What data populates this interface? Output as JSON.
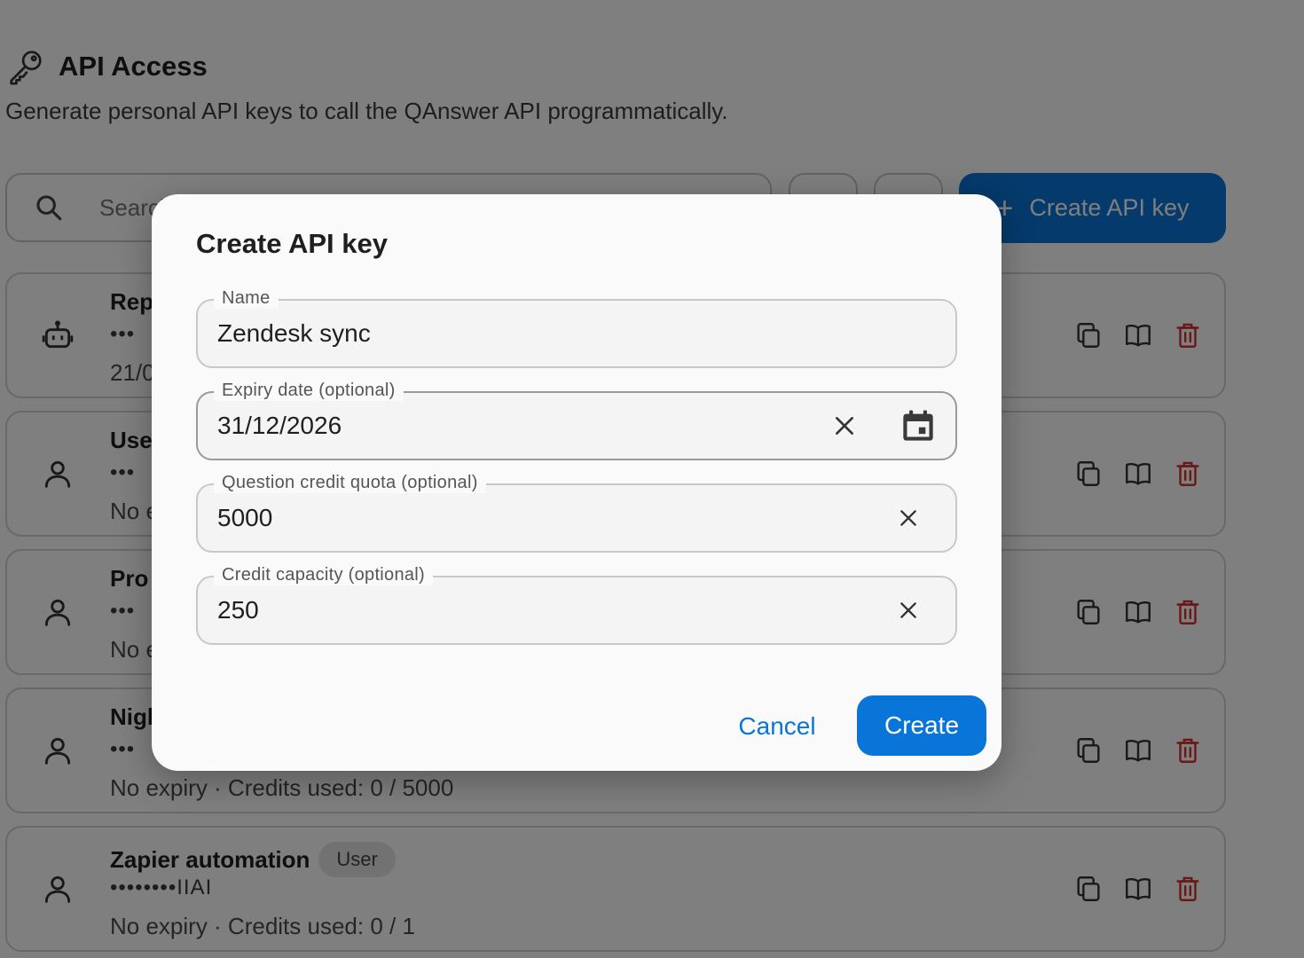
{
  "page": {
    "title": "API Access",
    "subtitle": "Generate personal API keys to call the QAnswer API programmatically.",
    "search_placeholder": "Search",
    "create_key_label": "Create API key"
  },
  "keys": [
    {
      "name": "Rep",
      "mask": "•••",
      "meta": "21/0",
      "badge": "",
      "icon": "robot-icon"
    },
    {
      "name": "Use",
      "mask": "•••",
      "meta": "No e",
      "badge": "",
      "icon": "user-icon"
    },
    {
      "name": "Pro",
      "mask": "•••",
      "meta": "No e",
      "badge": "",
      "icon": "user-icon"
    },
    {
      "name": "Nigl",
      "mask": "•••",
      "meta": "No expiry · Credits used: 0 / 5000",
      "badge": "",
      "icon": "user-icon"
    },
    {
      "name": "Zapier automation",
      "mask": "••••••••IIAI",
      "meta": "No expiry · Credits used: 0 / 1",
      "badge": "User",
      "icon": "user-icon"
    }
  ],
  "dialog": {
    "title": "Create API key",
    "name_label": "Name",
    "name_value": "Zendesk sync",
    "expiry_label": "Expiry date (optional)",
    "expiry_value": "31/12/2026",
    "quota_label": "Question credit quota (optional)",
    "quota_value": "5000",
    "capacity_label": "Credit capacity (optional)",
    "capacity_value": "250",
    "cancel_label": "Cancel",
    "create_label": "Create"
  },
  "colors": {
    "accent": "#0a75d8",
    "danger": "#d32f2f",
    "overlay": "rgba(0,0,0,0.5)"
  }
}
